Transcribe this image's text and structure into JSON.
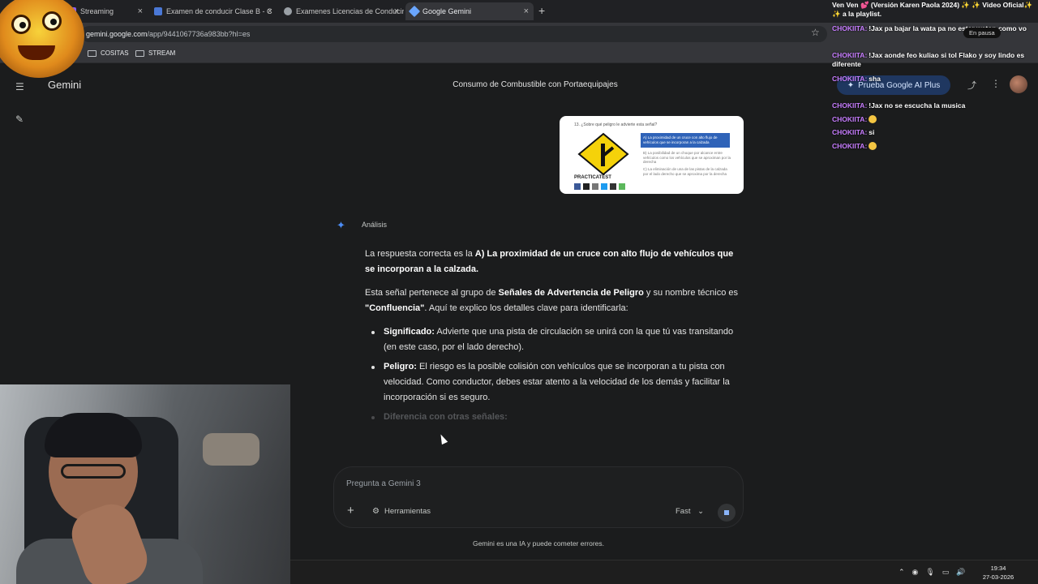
{
  "browser": {
    "tabs": [
      {
        "label": "Streaming",
        "fav_color": "#8b5cf6"
      },
      {
        "label": "Examen de conducir Clase B - C",
        "fav_color": "#4a78d6"
      },
      {
        "label": "Examenes Licencias de Conducir",
        "fav_color": "#9aa0a6"
      },
      {
        "label": "Google Gemini",
        "fav_color": "#6aa6ff"
      }
    ],
    "url_host": "gemini.google.com",
    "url_path": "/app/9441067736a983bb?hl=es",
    "bookmarks": [
      "COSITAS",
      "STREAM"
    ]
  },
  "gemini": {
    "brand": "Gemini",
    "conversation_title": "Consumo de Combustible con Portaequipajes",
    "upgrade_label": "Prueba Google AI Plus",
    "attachment": {
      "question": "13. ¿Sobre qué peligro le advierte esta señal?",
      "answer_option": "A) La proximidad de un cruce con alto flujo de vehículos que se incorporan a la calzada",
      "option_b": "B) La posibilidad de un choque por alcance entre vehículos como los vehículos que se aproximan por la derecha",
      "option_c": "C) La eliminación de una de las pistas de la calzada por el lado derecho que se aproxima por la derecha",
      "brand": "PRACTICATEST"
    },
    "thinking_label": "Análisis",
    "answer": {
      "p1_prefix": "La respuesta correcta es la ",
      "p1_bold": "A) La proximidad de un cruce con alto flujo de vehículos que se incorporan a la calzada.",
      "p2_prefix": "Esta señal pertenece al grupo de ",
      "p2_bold1": "Señales de Advertencia de Peligro",
      "p2_middle": " y su nombre técnico es ",
      "p2_bold2": "\"Confluencia\"",
      "p2_suffix": ". Aquí te explico los detalles clave para identificarla:",
      "bullets": [
        {
          "title": "Significado:",
          "text": " Advierte que una pista de circulación se unirá con la que tú vas transitando (en este caso, por el lado derecho)."
        },
        {
          "title": "Peligro:",
          "text": " El riesgo es la posible colisión con vehículos que se incorporan a tu pista con velocidad. Como conductor, debes estar atento a la velocidad de los demás y facilitar la incorporación si es seguro."
        },
        {
          "title": "Diferencia con otras señales:",
          "text": ""
        }
      ]
    },
    "composer": {
      "placeholder": "Pregunta a Gemini 3",
      "tools_label": "Herramientas",
      "mode_label": "Fast"
    },
    "disclaimer": "Gemini es una IA y puede cometer errores."
  },
  "chat_overlay": {
    "header": "Ven Ven 💕 (Versión Karen Paola 2024) ✨ ✨ Video Oficial✨ ✨ a la playlist.",
    "messages": [
      {
        "user": "CHOKIITA:",
        "text": "!Jax pa bajar la wata pa no estar waton como vo"
      },
      {
        "user": "CHOKIITA:",
        "text": "!Jax aonde feo kuliao si tol Flako y soy lindo es diferente"
      },
      {
        "user": "CHOKIITA:",
        "text": "sha"
      },
      {
        "user": "CHOKIITA:",
        "text": "!Jax no se escucha la musica"
      },
      {
        "user": "CHOKIITA:",
        "text": ""
      },
      {
        "user": "CHOKIITA:",
        "text": "si"
      },
      {
        "user": "CHOKIITA:",
        "text": ""
      }
    ],
    "pause_label": "En pausa"
  },
  "taskbar": {
    "time": "19:34",
    "date": "27-03-2026"
  }
}
